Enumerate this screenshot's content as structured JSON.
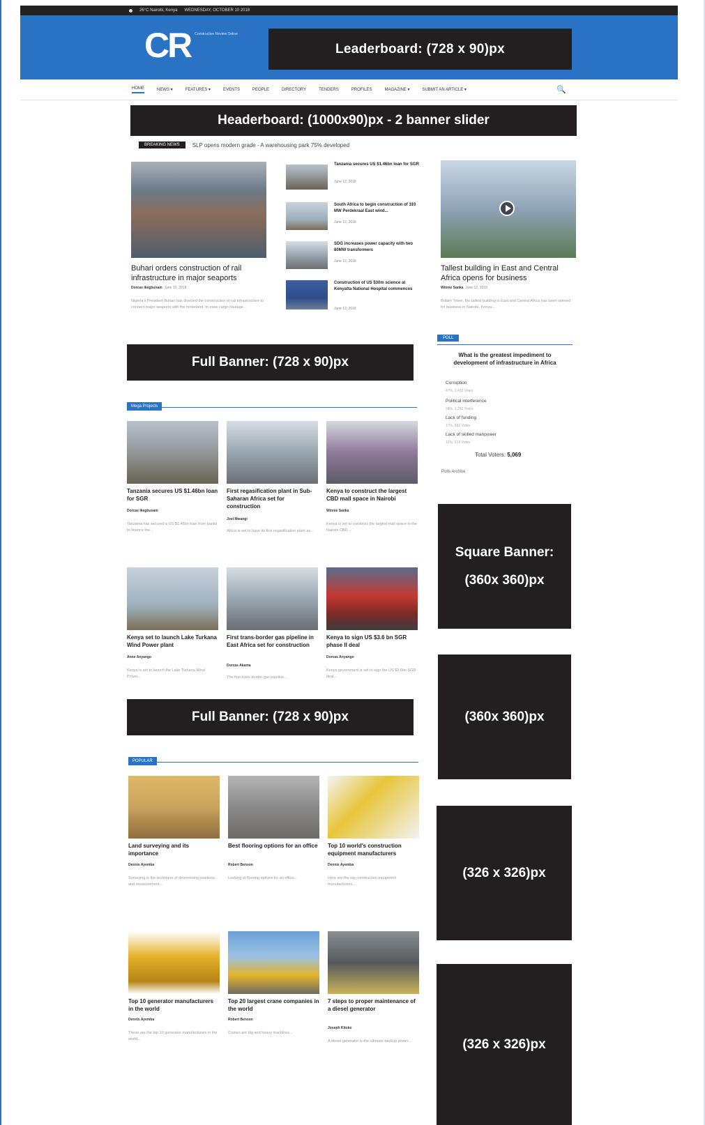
{
  "topbar": {
    "weather": "26°C Nairobi, Kenya",
    "date": "WEDNESDAY, OCTOBER 10 2018"
  },
  "header": {
    "logo": "CR",
    "logo_tagline": "Construction Review Online",
    "leaderboard": "Leaderboard:  (728 x 90)px"
  },
  "nav": {
    "items": [
      "HOME",
      "NEWS ▾",
      "FEATURES ▾",
      "EVENTS",
      "PEOPLE",
      "DIRECTORY",
      "TENDERS",
      "PROFILES",
      "MAGAZINE ▾",
      "SUBMIT AN ARTICLE ▾"
    ],
    "search_icon": "search-icon"
  },
  "headerboard": "Headerboard: (1000x90)px - 2 banner slider",
  "ticker": {
    "tag": "BREAKING NEWS",
    "text": "SLP opens modern grade - A warehousing park 75% developed"
  },
  "featured": {
    "left": {
      "title": "Buhari orders construction of rail infrastructure in major seaports",
      "author": "Dorcas Ikegbunam",
      "date": "June 13, 2018",
      "excerpt": "Nigeria's President Buhari has directed the construction of rail infrastructure to connect major seaports with the hinterland, to ease cargo haulage..."
    },
    "mid": [
      {
        "title": "Tanzania secures US $1.46bn loan for SGR",
        "date": "June 12, 2018"
      },
      {
        "title": "South Africa to begin construction of 310 MW Perdekraal East wind...",
        "date": "June 12, 2018"
      },
      {
        "title": "SDG increases power capacity with two 80MW transformers",
        "date": "June 12, 2018"
      },
      {
        "title": "Construction of US $30m science at Kenyatta National Hospital commences",
        "date": "June 12, 2018"
      }
    ],
    "right": {
      "title": "Tallest building in East and Central Africa opens for business",
      "author": "Winnie Sanka",
      "date": "June 12, 2018",
      "excerpt": "Britam Tower, the tallest building in East and Central Africa has been opened for business in Nairobi, Kenya..."
    }
  },
  "banners": {
    "full1": "Full Banner:  (728 x 90)px",
    "full2": "Full Banner:  (728 x 90)px",
    "square1": "Square Banner:",
    "square1_size": "(360x 360)px",
    "square2": "(360x 360)px",
    "square3": "(326 x 326)px",
    "square4": "(326 x 326)px"
  },
  "sections": {
    "projects": "Mega Projects",
    "popular": "POPULAR"
  },
  "projects": [
    {
      "title": "Tanzania secures US $1.46bn loan for SGR",
      "author": "Dorcas Ikegbunam",
      "excerpt": "Tanzania has secured a US $1.46bn loan from banks to finance the..."
    },
    {
      "title": "First regasification plant in Sub-Saharan Africa set for construction",
      "author": "Joel Mwangi",
      "excerpt": "Africa is set to have its first regasification plant as..."
    },
    {
      "title": "Kenya to construct the largest CBD mall space in Nairobi",
      "author": "Winnie Sanka",
      "excerpt": "Kenya is set to construct the largest mall space in the Nairobi CBD..."
    },
    {
      "title": "Kenya set to launch Lake Turkana Wind Power plant",
      "author": "Anne Anyango",
      "excerpt": "Kenya is set to launch the Lake Turkana Wind Power..."
    },
    {
      "title": "First trans-border gas pipeline in East Africa set for construction",
      "author": "Dorcas Akama",
      "excerpt": "The first trans-border gas pipeline..."
    },
    {
      "title": "Kenya to sign US $3.6 bn SGR phase II deal",
      "author": "Dorcas Anyango",
      "excerpt": "Kenya government is set to sign the US $3.6bn SGR deal..."
    }
  ],
  "popular": [
    {
      "title": "Land surveying and its importance",
      "author": "Dennis Ayemba",
      "excerpt": "Surveying is the technique of determining positions and measurement..."
    },
    {
      "title": "Best flooring options for an office",
      "author": "Robert Benson",
      "excerpt": "Looking at flooring options for an office..."
    },
    {
      "title": "Top 10 world's construction equipment manufacturers",
      "author": "Dennis Ayemba",
      "excerpt": "Here are the top construction equipment manufacturers..."
    },
    {
      "title": "Top 10 generator manufacturers in the world",
      "author": "Dennis Ayemba",
      "excerpt": "These are the top 10 generator manufacturers in the world..."
    },
    {
      "title": "Top 20 largest crane companies in the world",
      "author": "Robert Benson",
      "excerpt": "Cranes are big and heavy machines..."
    },
    {
      "title": "7 steps to proper maintenance of a diesel generator",
      "author": "Joseph Kitoko",
      "excerpt": "A diesel generator is the ultimate backup power..."
    }
  ],
  "poll": {
    "tag": "POLL",
    "question": "What is the greatest impediment to development of infrastructure in Africa",
    "options": [
      {
        "label": "Corruption",
        "sub": "47%, 2,432 Votes"
      },
      {
        "label": "Political interference",
        "sub": "24%, 1,250 Votes"
      },
      {
        "label": "Lack of funding",
        "sub": "17%, 882 Votes"
      },
      {
        "label": "Lack of skilled manpower",
        "sub": "12%, 614 Votes"
      }
    ],
    "total_label": "Total Voters:",
    "total": "5,069",
    "results": "Polls Archive"
  }
}
